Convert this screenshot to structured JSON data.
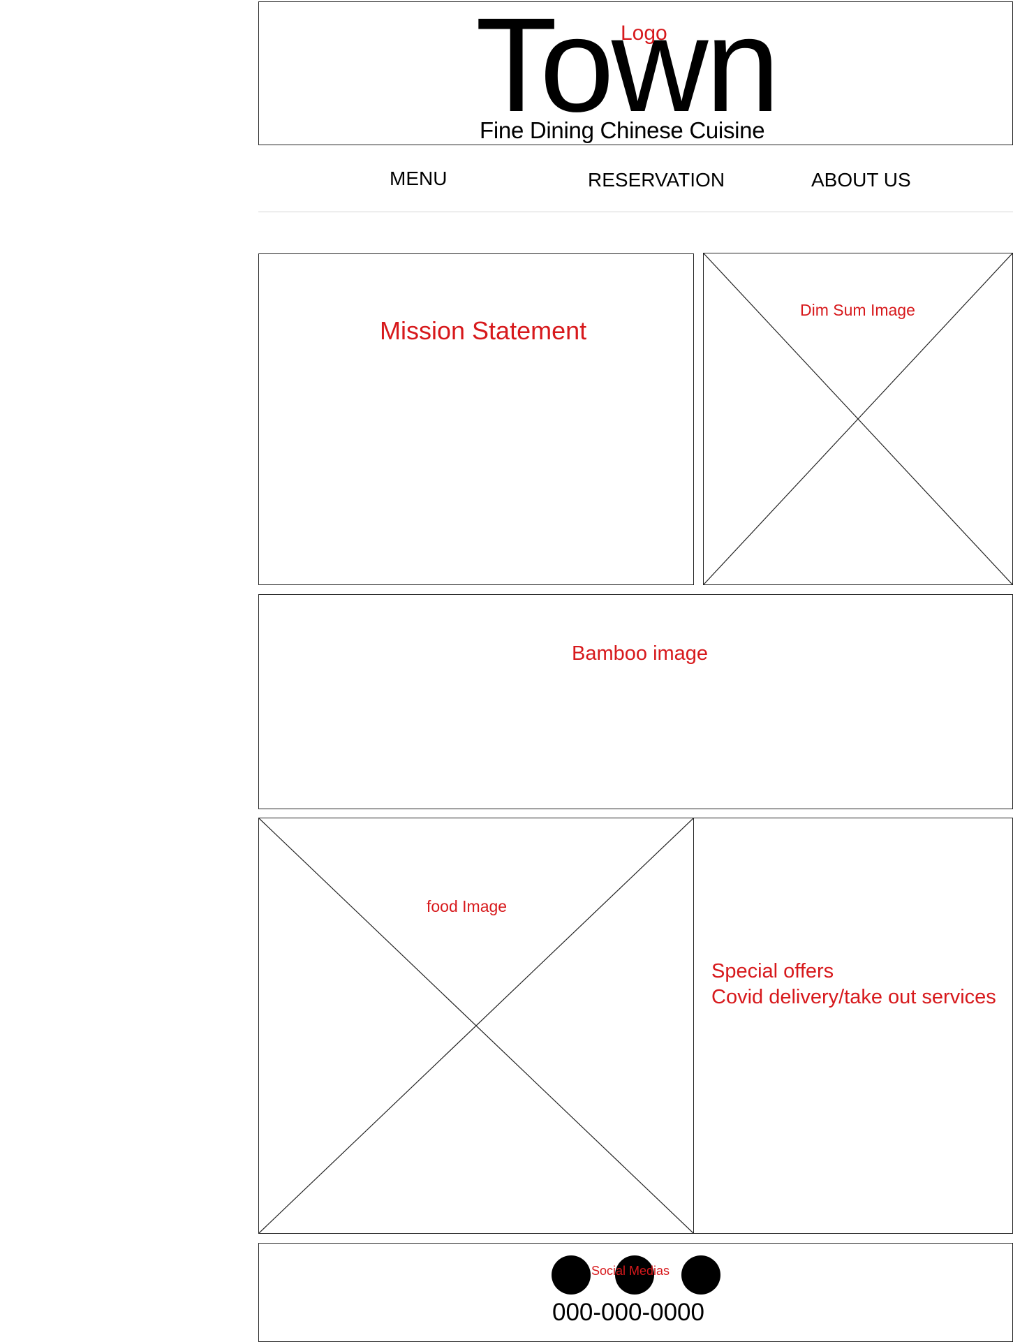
{
  "header": {
    "logo_label": "Logo",
    "logo_text": "Town",
    "tagline": "Fine Dining Chinese Cuisine"
  },
  "nav": {
    "items": [
      {
        "label": "MENU"
      },
      {
        "label": "RESERVATION"
      },
      {
        "label": "ABOUT US"
      }
    ]
  },
  "mission": {
    "title": "Mission Statement"
  },
  "dimsum": {
    "label": "Dim Sum Image"
  },
  "bamboo": {
    "label": "Bamboo image"
  },
  "food": {
    "label": "food Image"
  },
  "offers": {
    "line1": "Special offers",
    "line2": "Covid delivery/take out services"
  },
  "footer": {
    "social_label": "Social Medias",
    "phone": "000-000-0000"
  },
  "colors": {
    "annotation": "#d7191c",
    "text": "#000000",
    "border": "#222222"
  }
}
